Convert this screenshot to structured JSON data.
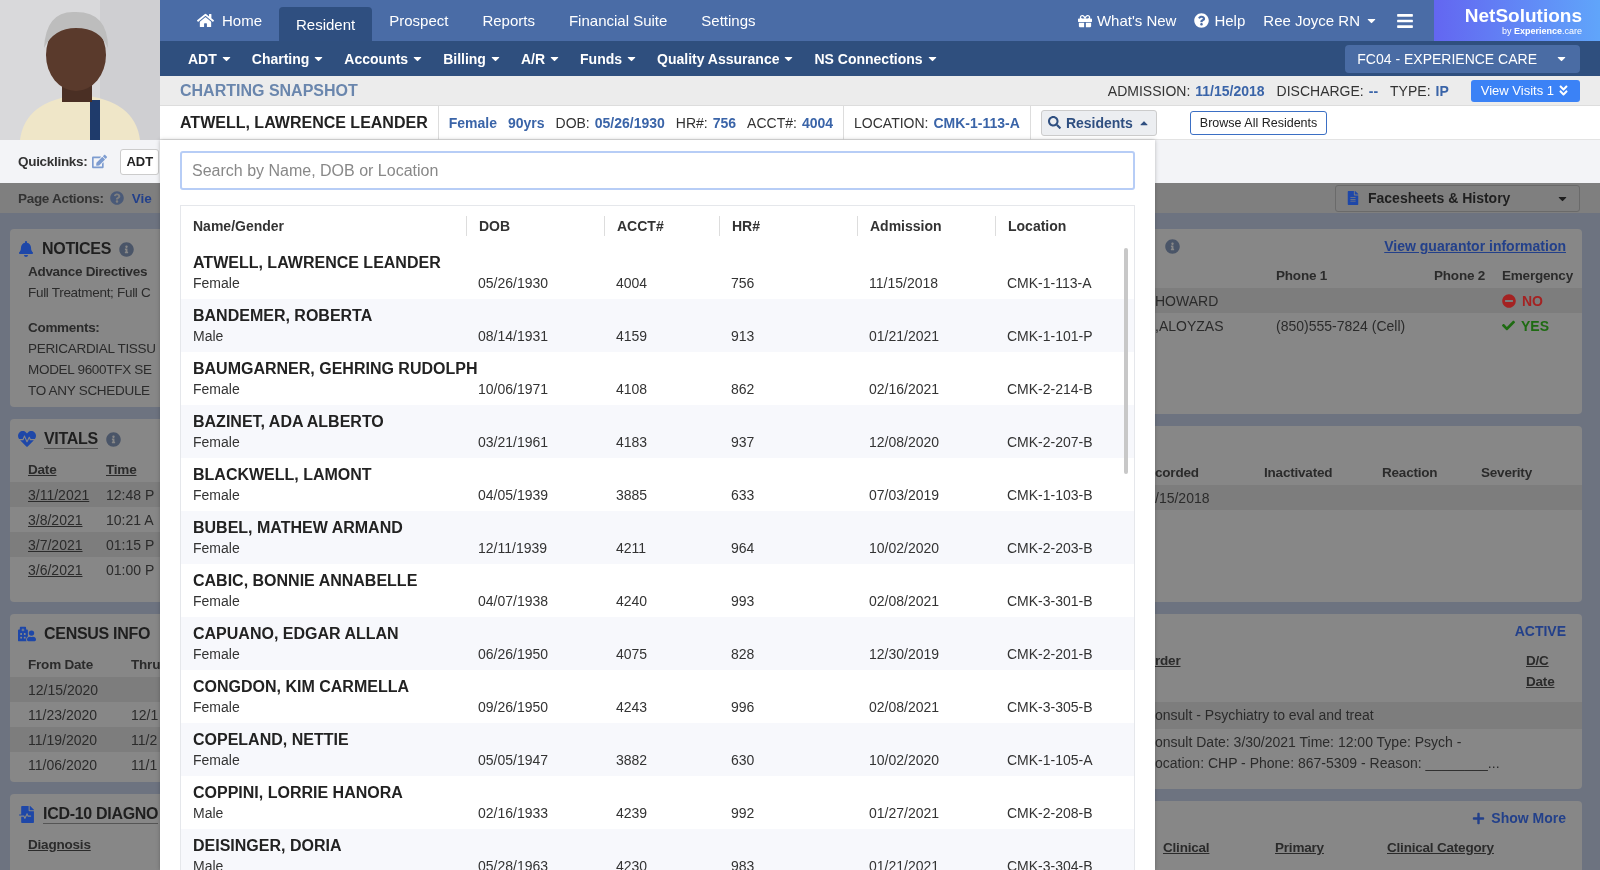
{
  "top_nav": {
    "tabs": [
      {
        "label": "Home",
        "selected": false
      },
      {
        "label": "Resident",
        "selected": true
      },
      {
        "label": "Prospect",
        "selected": false
      },
      {
        "label": "Reports",
        "selected": false
      },
      {
        "label": "Financial Suite",
        "selected": false
      },
      {
        "label": "Settings",
        "selected": false
      }
    ],
    "whats_new": "What's New",
    "help": "Help",
    "user": "Ree Joyce RN"
  },
  "logo": {
    "name": "NetSolutions",
    "tagline": "by **Experience**.care"
  },
  "menu_bar": {
    "items": [
      "ADT",
      "Charting",
      "Accounts",
      "Billing",
      "A/R",
      "Funds",
      "Quality Assurance",
      "NS Connections"
    ],
    "facility": "FC04 - EXPERIENCE CARE"
  },
  "snapshot": {
    "title": "CHARTING SNAPSHOT",
    "fields": [
      {
        "label": "ADMISSION:",
        "value": "11/15/2018"
      },
      {
        "label": "DISCHARGE:",
        "value": "--"
      },
      {
        "label": "TYPE:",
        "value": "IP"
      }
    ],
    "view_visits": "View Visits 1"
  },
  "resident": {
    "name": "ATWELL, LAWRENCE LEANDER",
    "gender": "Female",
    "age": "90yrs",
    "fields": [
      {
        "label": "DOB:",
        "value": "05/26/1930"
      },
      {
        "label": "HR#:",
        "value": "756"
      },
      {
        "label": "ACCT#:",
        "value": "4004"
      }
    ],
    "location_label": "LOCATION:",
    "location": "CMK-1-113-A",
    "residents_button": "Residents",
    "browse_button": "Browse All Residents"
  },
  "quicklinks": {
    "label": "Quicklinks:",
    "items": [
      "ADT"
    ]
  },
  "page_actions": {
    "label": "Page Actions:",
    "link": "Vie",
    "facesheets": "Facesheets & History"
  },
  "search": {
    "placeholder": "Search by Name, DOB or Location"
  },
  "results": {
    "columns": [
      "Name/Gender",
      "DOB",
      "ACCT#",
      "HR#",
      "Admission",
      "Location"
    ],
    "rows": [
      {
        "name": "ATWELL, LAWRENCE LEANDER",
        "gender": "Female",
        "dob": "05/26/1930",
        "acct": "4004",
        "hr": "756",
        "admission": "11/15/2018",
        "location": "CMK-1-113-A"
      },
      {
        "name": "BANDEMER, ROBERTA",
        "gender": "Male",
        "dob": "08/14/1931",
        "acct": "4159",
        "hr": "913",
        "admission": "01/21/2021",
        "location": "CMK-1-101-P"
      },
      {
        "name": "BAUMGARNER, GEHRING RUDOLPH",
        "gender": "Female",
        "dob": "10/06/1971",
        "acct": "4108",
        "hr": "862",
        "admission": "02/16/2021",
        "location": "CMK-2-214-B"
      },
      {
        "name": "BAZINET, ADA ALBERTO",
        "gender": "Female",
        "dob": "03/21/1961",
        "acct": "4183",
        "hr": "937",
        "admission": "12/08/2020",
        "location": "CMK-2-207-B"
      },
      {
        "name": "BLACKWELL, LAMONT",
        "gender": "Female",
        "dob": "04/05/1939",
        "acct": "3885",
        "hr": "633",
        "admission": "07/03/2019",
        "location": "CMK-1-103-B"
      },
      {
        "name": "BUBEL, MATHEW ARMAND",
        "gender": "Female",
        "dob": "12/11/1939",
        "acct": "4211",
        "hr": "964",
        "admission": "10/02/2020",
        "location": "CMK-2-203-B"
      },
      {
        "name": "CABIC, BONNIE ANNABELLE",
        "gender": "Female",
        "dob": "04/07/1938",
        "acct": "4240",
        "hr": "993",
        "admission": "02/08/2021",
        "location": "CMK-3-301-B"
      },
      {
        "name": "CAPUANO, EDGAR ALLAN",
        "gender": "Female",
        "dob": "06/26/1950",
        "acct": "4075",
        "hr": "828",
        "admission": "12/30/2019",
        "location": "CMK-2-201-B"
      },
      {
        "name": "CONGDON, KIM CARMELLA",
        "gender": "Female",
        "dob": "09/26/1950",
        "acct": "4243",
        "hr": "996",
        "admission": "02/08/2021",
        "location": "CMK-3-305-B"
      },
      {
        "name": "COPELAND, NETTIE",
        "gender": "Female",
        "dob": "05/05/1947",
        "acct": "3882",
        "hr": "630",
        "admission": "10/02/2020",
        "location": "CMK-1-105-A"
      },
      {
        "name": "COPPINI, LORRIE HANORA",
        "gender": "Male",
        "dob": "02/16/1933",
        "acct": "4239",
        "hr": "992",
        "admission": "01/27/2021",
        "location": "CMK-2-208-B"
      },
      {
        "name": "DEISINGER, DORIA",
        "gender": "Male",
        "dob": "05/28/1963",
        "acct": "4230",
        "hr": "983",
        "admission": "01/21/2021",
        "location": "CMK-3-304-B"
      }
    ]
  },
  "notices": {
    "title": "NOTICES",
    "directive_label": "Advance Directives",
    "directive": "Full Treatment; Full C",
    "comments_label": "Comments:",
    "comments": [
      "PERICARDIAL TISSU",
      "MODEL 9600TFX SE",
      "TO ANY SCHEDULE"
    ]
  },
  "vitals": {
    "title": "VITALS",
    "columns": [
      "Date",
      "Time"
    ],
    "rows": [
      [
        "3/11/2021",
        "12:48 P"
      ],
      [
        "3/8/2021",
        "10:21 A"
      ],
      [
        "3/7/2021",
        "01:15 P"
      ],
      [
        "3/6/2021",
        "01:00 P"
      ]
    ]
  },
  "census": {
    "title": "CENSUS INFO",
    "columns": [
      "From Date",
      "Thru"
    ],
    "rows": [
      [
        "12/15/2020"
      ],
      [
        "11/23/2020",
        "12/1"
      ],
      [
        "11/19/2020",
        "11/2"
      ],
      [
        "11/06/2020",
        "11/1"
      ]
    ]
  },
  "diagnoses": {
    "title": "ICD-10 DIAGNO",
    "columns": [
      "Diagnosis"
    ]
  },
  "contacts": {
    "link": "View guarantor information",
    "columns": [
      "Phone 1",
      "Phone 2",
      "Emergency"
    ],
    "rows": [
      {
        "name": "HOWARD",
        "emergency_text": "NO",
        "emergency": false
      },
      {
        "name": ",ALOYZAS",
        "phone_1": "(850)555-7824 (Cell)",
        "emergency_text": "YES",
        "emergency": true
      }
    ]
  },
  "allergies": {
    "columns": [
      "corded",
      "Inactivated",
      "Reaction",
      "Severity"
    ],
    "rows": [
      [
        "/15/2018"
      ]
    ]
  },
  "orders": {
    "status": "ACTIVE",
    "columns": [
      "rder",
      "D/C Date"
    ],
    "rows": [
      {
        "lines": [
          "onsult - Psychiatry to eval and treat"
        ]
      },
      {
        "lines": [
          "onsult Date: 3/30/2021 Time: 12:00 Type: Psych -",
          "ocation: CHP - Phone: 867-5309 - Reason: ________..."
        ]
      }
    ]
  },
  "clinical": {
    "show_more": "Show More",
    "columns": [
      "Clinical",
      "Primary",
      "Clinical Category"
    ]
  }
}
